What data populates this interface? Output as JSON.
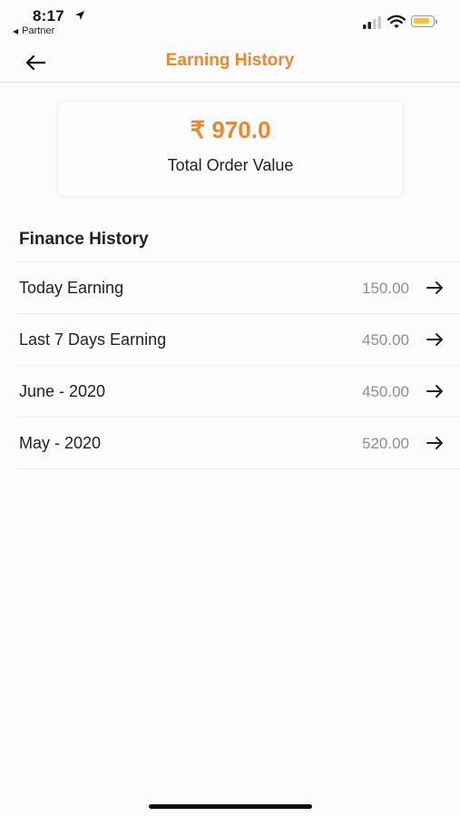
{
  "status_bar": {
    "time": "8:17",
    "back_app": "Partner",
    "battery_color": "#f2c33b"
  },
  "header": {
    "title": "Earning History",
    "back_icon": "arrow-left-icon"
  },
  "summary": {
    "amount": "₹ 970.0",
    "label": "Total Order Value"
  },
  "finance": {
    "title": "Finance History",
    "items": [
      {
        "label": "Today Earning",
        "value": "150.00"
      },
      {
        "label": "Last 7 Days Earning",
        "value": "450.00"
      },
      {
        "label": "June - 2020",
        "value": "450.00"
      },
      {
        "label": "May - 2020",
        "value": "520.00"
      }
    ]
  },
  "colors": {
    "accent": "#f0862b",
    "text": "#222222",
    "muted": "#8f8f8f"
  }
}
